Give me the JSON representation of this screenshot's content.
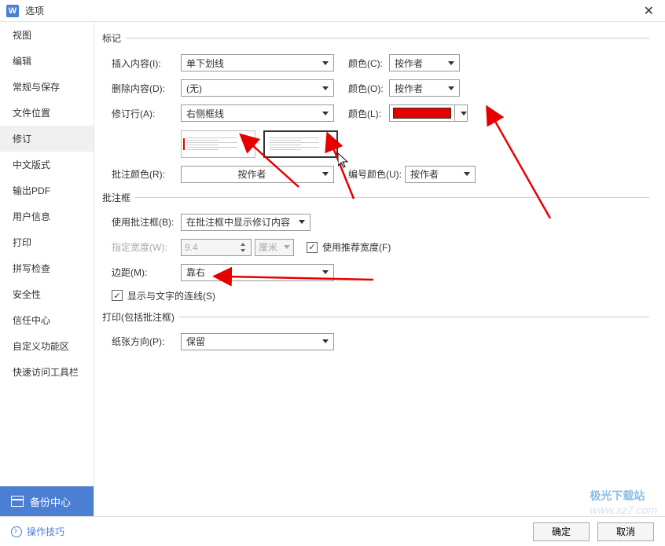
{
  "titlebar": {
    "title": "选项"
  },
  "sidebar": {
    "items": [
      {
        "label": "视图"
      },
      {
        "label": "编辑"
      },
      {
        "label": "常规与保存"
      },
      {
        "label": "文件位置"
      },
      {
        "label": "修订"
      },
      {
        "label": "中文版式"
      },
      {
        "label": "输出PDF"
      },
      {
        "label": "用户信息"
      },
      {
        "label": "打印"
      },
      {
        "label": "拼写检查"
      },
      {
        "label": "安全性"
      },
      {
        "label": "信任中心"
      },
      {
        "label": "自定义功能区"
      },
      {
        "label": "快速访问工具栏"
      }
    ],
    "active_index": 4,
    "backup_label": "备份中心"
  },
  "sections": {
    "markup": {
      "header": "标记",
      "insert_label": "插入内容(I):",
      "insert_value": "单下划线",
      "delete_label": "删除内容(D):",
      "delete_value": "(无)",
      "changed_label": "修订行(A):",
      "changed_value": "右侧框线",
      "color_c_label": "颜色(C):",
      "color_c_value": "按作者",
      "color_o_label": "颜色(O):",
      "color_o_value": "按作者",
      "color_l_label": "颜色(L):",
      "comment_color_label": "批注颜色(R):",
      "comment_color_value": "按作者",
      "number_color_label": "编号颜色(U):",
      "number_color_value": "按作者"
    },
    "balloon": {
      "header": "批注框",
      "use_label": "使用批注框(B):",
      "use_value": "在批注框中显示修订内容",
      "width_label": "指定宽度(W):",
      "width_value": "9.4",
      "unit_value": "厘米",
      "recommend_label": "使用推荐宽度(F)",
      "margin_label": "边距(M):",
      "margin_value": "靠右",
      "connector_label": "显示与文字的连线(S)"
    },
    "print": {
      "header": "打印(包括批注框)",
      "orient_label": "纸张方向(P):",
      "orient_value": "保留"
    }
  },
  "footer": {
    "tips_label": "操作技巧",
    "ok_label": "确定",
    "cancel_label": "取消"
  },
  "watermark": {
    "brand": "极光下载站",
    "url": "www.xz7.com"
  },
  "colors": {
    "accent_red": "#e60000"
  }
}
